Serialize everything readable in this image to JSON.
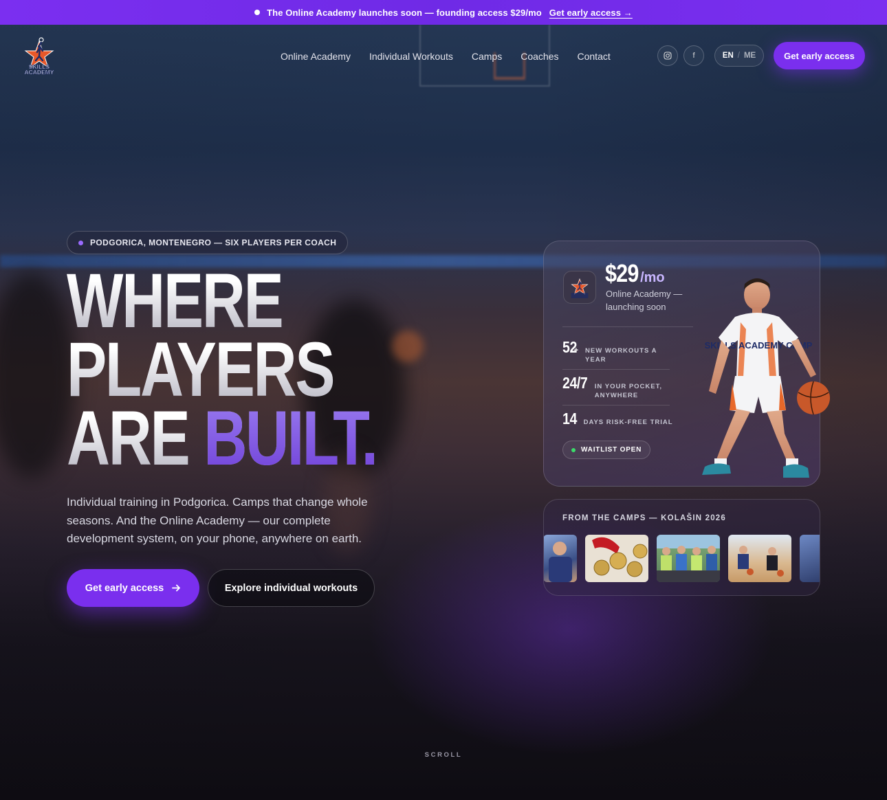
{
  "announcement": {
    "text": "The Online Academy launches soon — founding access $29/mo",
    "link": "Get early access →"
  },
  "brand": {
    "logo_text_1": "SKILLS",
    "logo_text_2": "ACADEMY"
  },
  "nav": {
    "items": [
      "Online Academy",
      "Individual Workouts",
      "Camps",
      "Coaches",
      "Contact"
    ]
  },
  "social": {
    "instagram": "instagram-icon",
    "facebook": "f"
  },
  "lang": {
    "active": "EN",
    "separator": "/",
    "other": "ME"
  },
  "header_cta": "Get early access",
  "hero": {
    "eyebrow": "PODGORICA, MONTENEGRO — SIX PLAYERS PER COACH",
    "headline_1": "WHERE",
    "headline_2": "PLAYERS",
    "headline_3a": "ARE",
    "headline_3b": "BUILT.",
    "lead": "Individual training in Podgorica. Camps that change whole seasons. And the Online Academy — our complete development system, on your phone, anywhere on earth.",
    "primary_cta": "Get early access",
    "secondary_cta": "Explore individual workouts"
  },
  "price_card": {
    "price": "$29",
    "period": "/mo",
    "subtitle": "Online Academy — launching soon",
    "stats": [
      {
        "value": "52",
        "suffix": "+",
        "label": "NEW WORKOUTS A YEAR"
      },
      {
        "value": "24/7",
        "suffix": "",
        "label": "IN YOUR POCKET, ANYWHERE"
      },
      {
        "value": "14",
        "suffix": "",
        "label": "DAYS RISK-FREE TRIAL"
      }
    ],
    "badge": "WAITLIST OPEN",
    "jersey_text": "SKILLS ACADEMY CAMP"
  },
  "camps": {
    "title": "FROM THE CAMPS — KOLAŠIN 2026"
  },
  "scroll": "SCROLL",
  "colors": {
    "accent": "#7a2fee",
    "accent_light": "#9a6bff",
    "status_green": "#3bdc6a"
  }
}
